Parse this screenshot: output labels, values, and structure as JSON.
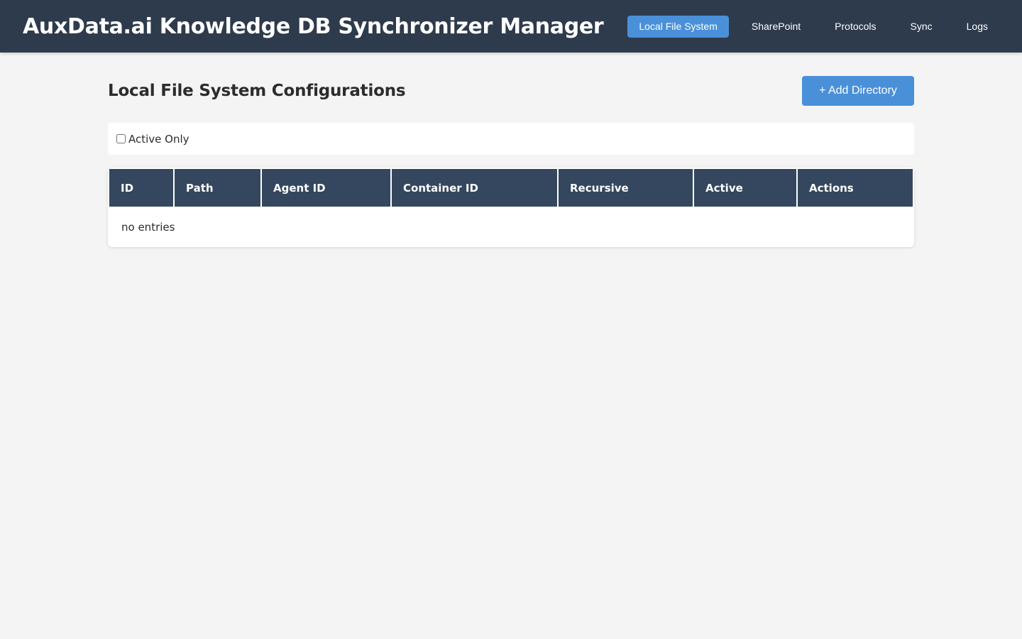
{
  "app": {
    "title": "AuxData.ai Knowledge DB Synchronizer Manager"
  },
  "nav": {
    "tabs": [
      {
        "label": "Local File System",
        "active": true
      },
      {
        "label": "SharePoint",
        "active": false
      },
      {
        "label": "Protocols",
        "active": false
      },
      {
        "label": "Sync",
        "active": false
      },
      {
        "label": "Logs",
        "active": false
      }
    ]
  },
  "main": {
    "title": "Local File System Configurations",
    "add_button_label": "+ Add Directory",
    "filter": {
      "active_only_label": "Active Only",
      "active_only_checked": false
    },
    "table": {
      "columns": [
        "ID",
        "Path",
        "Agent ID",
        "Container ID",
        "Recursive",
        "Active",
        "Actions"
      ],
      "rows": [],
      "empty_text": "no entries"
    }
  },
  "colors": {
    "header_bg": "#2e3b4c",
    "accent": "#4a90d9",
    "table_header_bg": "#34475e",
    "page_bg": "#f4f4f4"
  }
}
